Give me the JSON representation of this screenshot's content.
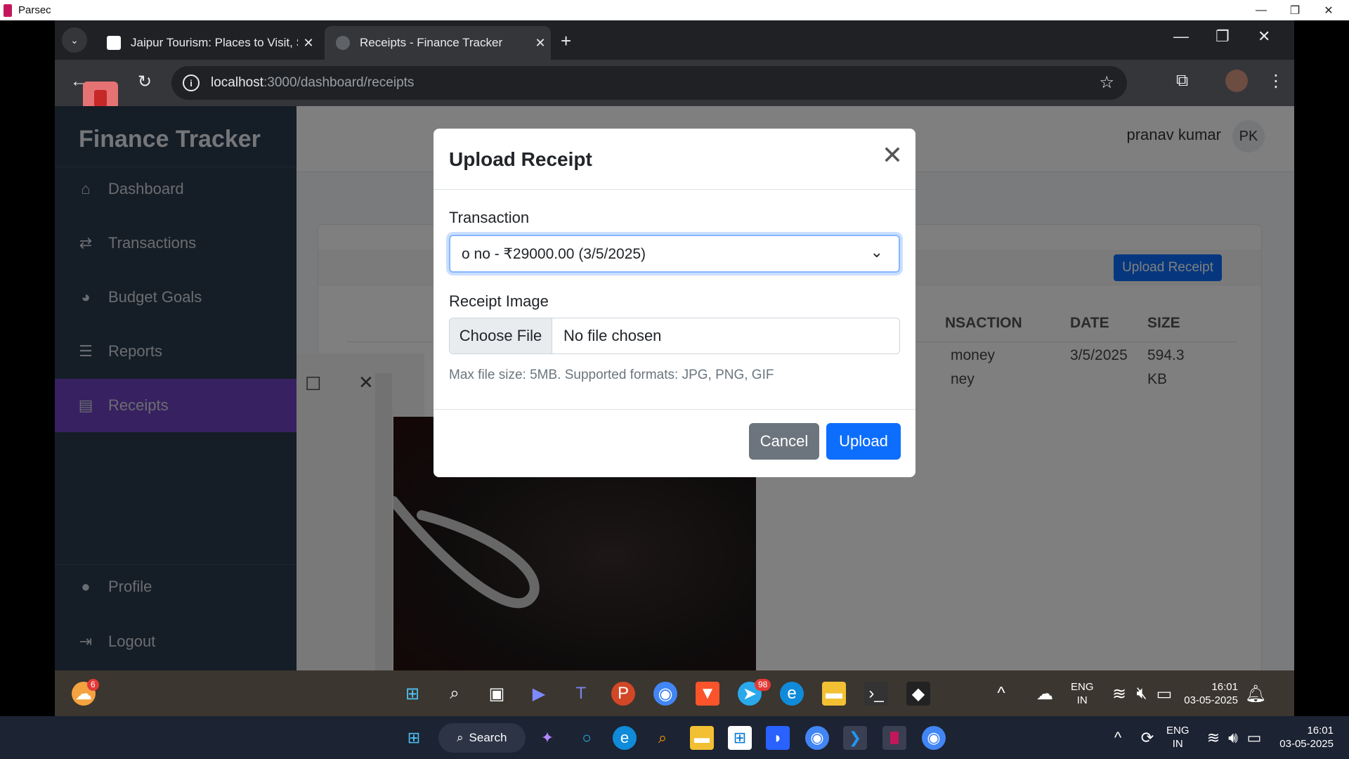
{
  "parsec": {
    "title": "Parsec"
  },
  "browser": {
    "tabs": [
      {
        "title": "Jaipur Tourism: Places to Visit, S",
        "active": false
      },
      {
        "title": "Receipts - Finance Tracker",
        "active": true
      }
    ],
    "url_host": "localhost",
    "url_path": ":3000/dashboard/receipts"
  },
  "sidebar": {
    "brand": "Finance Tracker",
    "items": [
      {
        "label": "Dashboard",
        "icon": "home-icon"
      },
      {
        "label": "Transactions",
        "icon": "exchange-icon"
      },
      {
        "label": "Budget Goals",
        "icon": "pie-chart-icon"
      },
      {
        "label": "Reports",
        "icon": "list-chart-icon"
      },
      {
        "label": "Receipts",
        "icon": "receipt-icon",
        "active": true
      }
    ],
    "bottom_items": [
      {
        "label": "Profile",
        "icon": "user-icon"
      },
      {
        "label": "Logout",
        "icon": "logout-icon"
      }
    ]
  },
  "header": {
    "user_name": "pranav kumar",
    "user_initials": "PK"
  },
  "receipts_page": {
    "upload_button": "Upload Receipt",
    "columns": [
      "NSACTION",
      "DATE",
      "SIZE"
    ],
    "row": {
      "transaction_line1": "money",
      "transaction_line2": "ney",
      "date": "3/5/2025",
      "size_line1": "594.3",
      "size_line2": "KB"
    }
  },
  "modal": {
    "title": "Upload Receipt",
    "transaction_label": "Transaction",
    "transaction_value": "o no - ₹29000.00 (3/5/2025)",
    "image_label": "Receipt Image",
    "choose_file": "Choose File",
    "no_file": "No file chosen",
    "help": "Max file size: 5MB. Supported formats: JPG, PNG, GIF",
    "cancel": "Cancel",
    "upload": "Upload"
  },
  "remote_taskbar": {
    "weather_badge": "6",
    "telegram_badge": "98",
    "lang_line1": "ENG",
    "lang_line2": "IN",
    "time": "16:01",
    "date": "03-05-2025"
  },
  "local_taskbar": {
    "search_label": "Search",
    "lang_line1": "ENG",
    "lang_line2": "IN",
    "time": "16:01",
    "date": "03-05-2025"
  },
  "colors": {
    "sidebar_bg": "#2a3a4c",
    "sidebar_active": "#6f42c1",
    "primary": "#0d6efd",
    "secondary": "#6c757d"
  }
}
